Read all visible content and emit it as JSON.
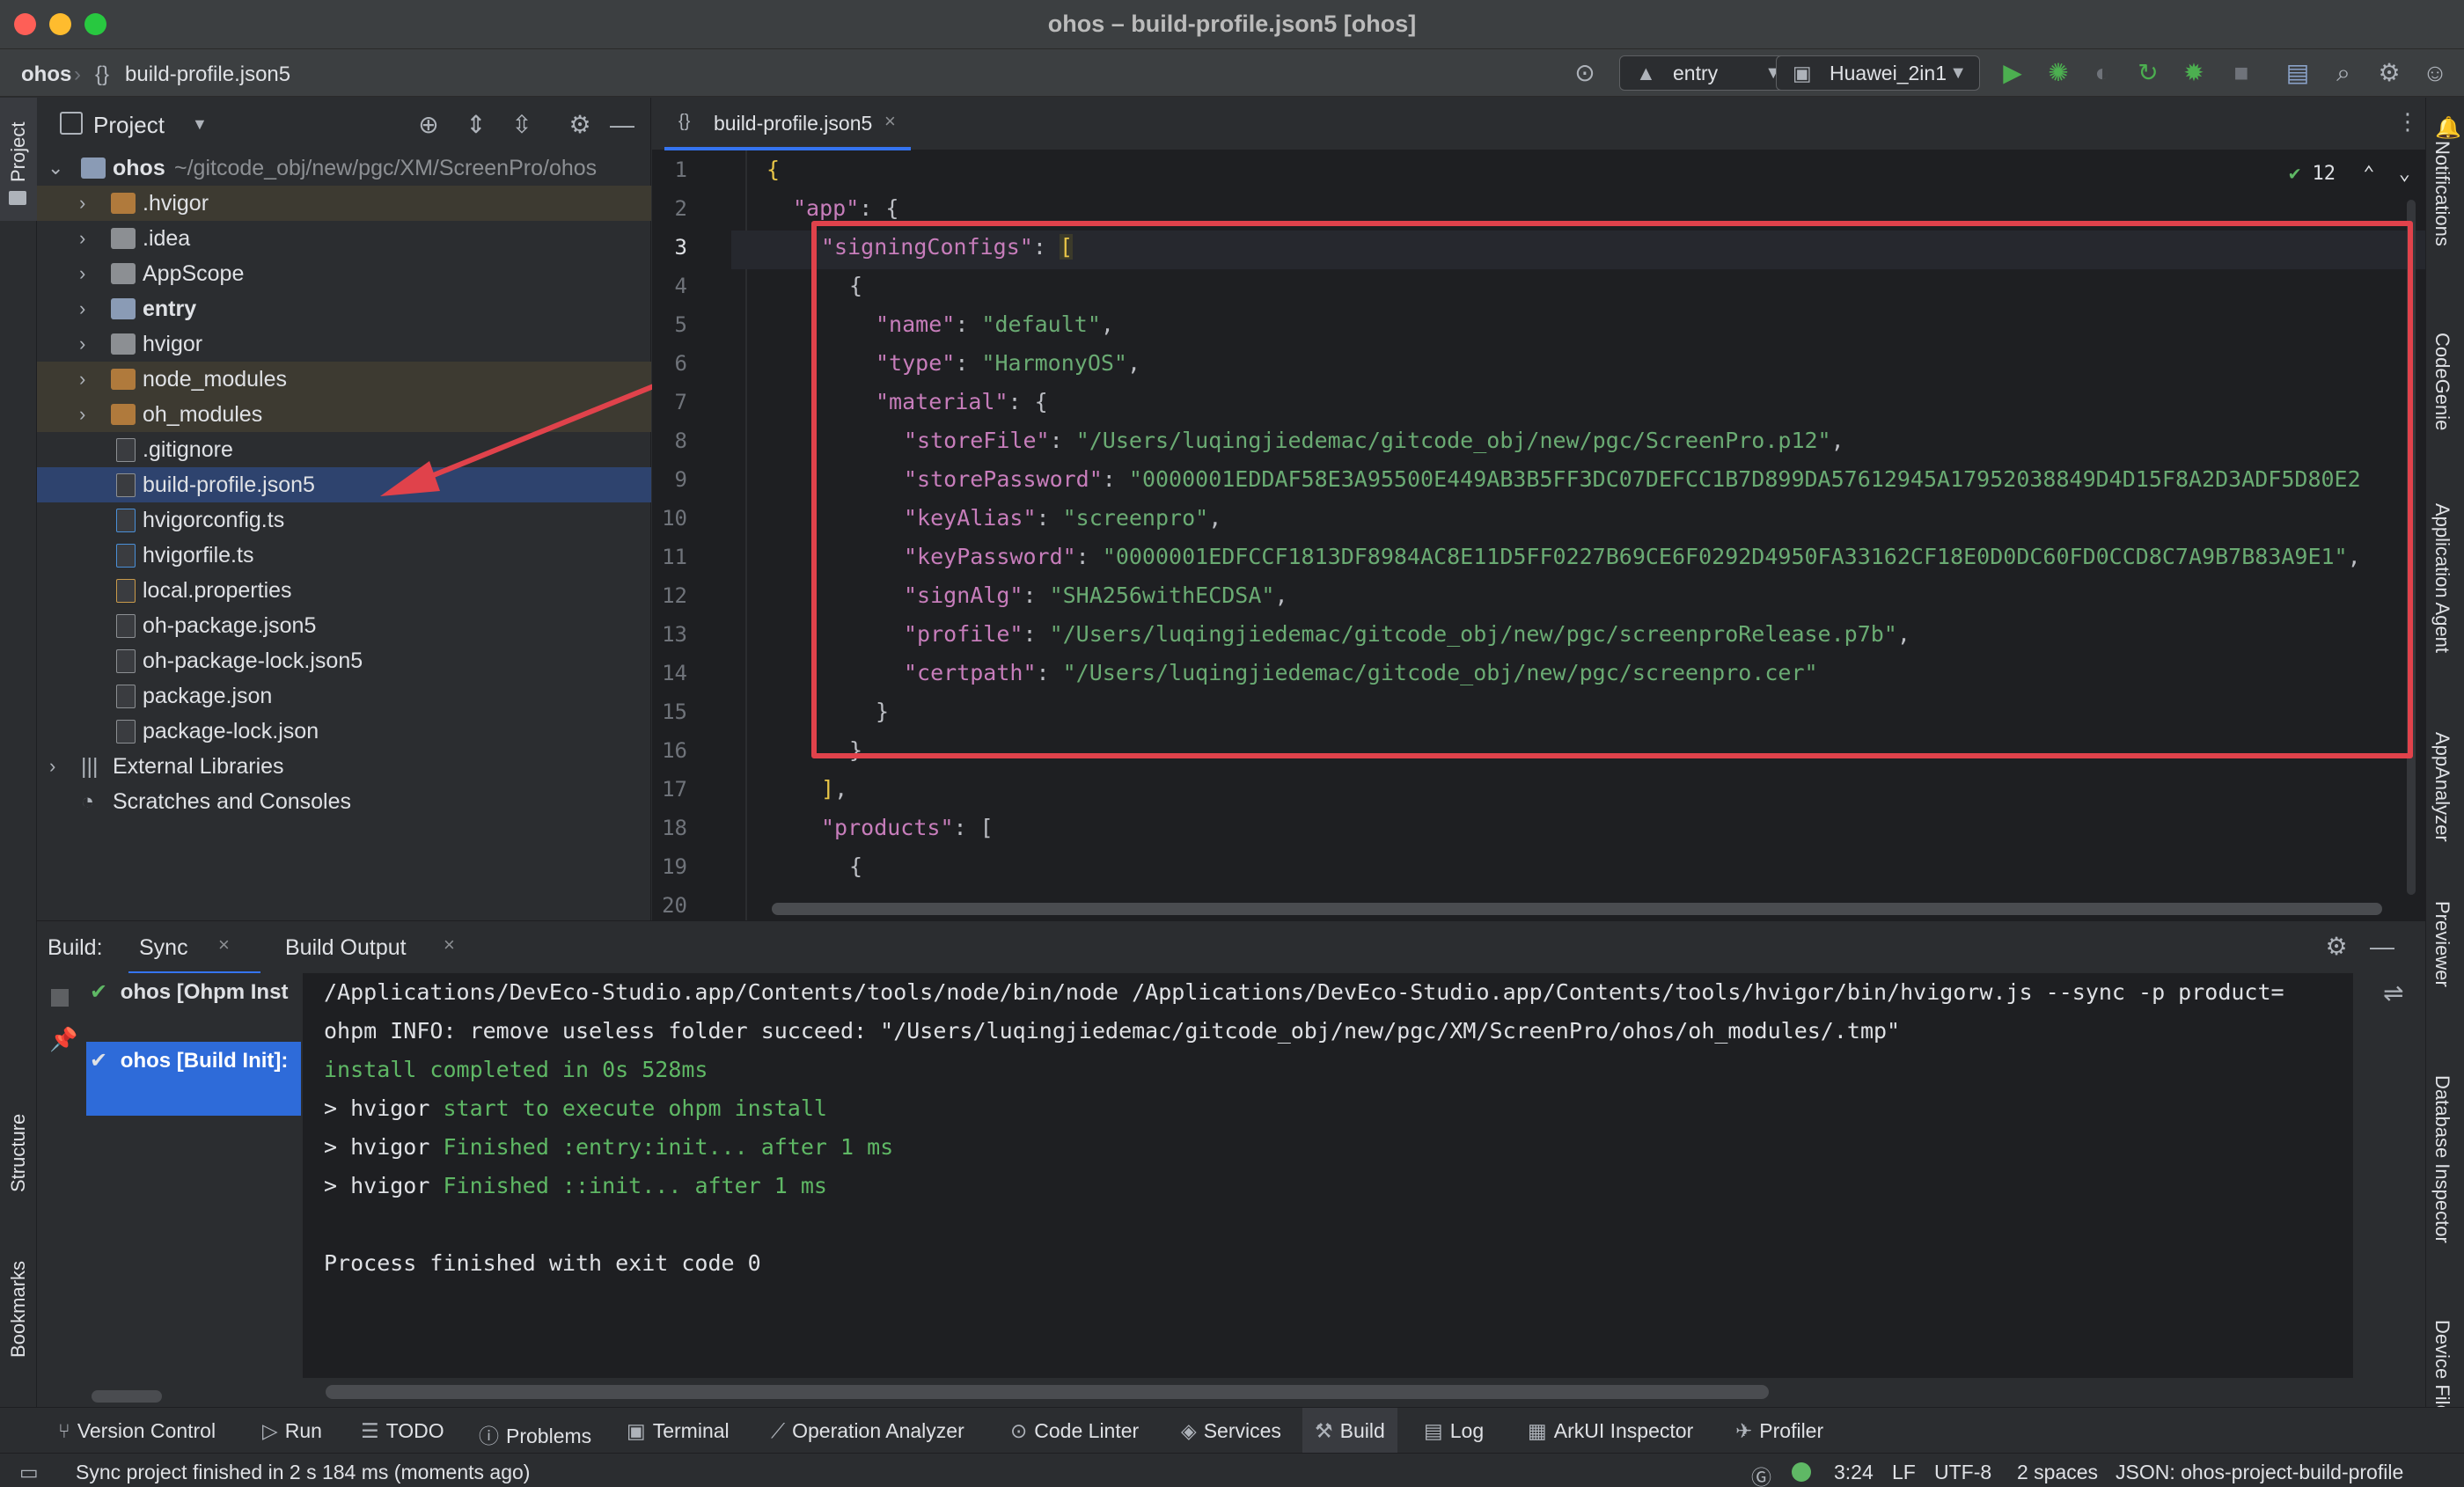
{
  "window": {
    "title": "ohos – build-profile.json5 [ohos]"
  },
  "nav": {
    "crumb_project": "ohos",
    "crumb_file": "build-profile.json5",
    "module_select": "entry",
    "device_select": "Huawei_2in1"
  },
  "left_strip": {
    "project_label": "Project",
    "structure_label": "Structure",
    "bookmarks_label": "Bookmarks"
  },
  "project": {
    "title": "Project",
    "root_name": "ohos",
    "root_path": "~/gitcode_obj/new/pgc/XM/ScreenPro/ohos",
    "items": [
      {
        "label": ".hvigor"
      },
      {
        "label": ".idea"
      },
      {
        "label": "AppScope"
      },
      {
        "label": "entry"
      },
      {
        "label": "hvigor"
      },
      {
        "label": "node_modules"
      },
      {
        "label": "oh_modules"
      },
      {
        "label": ".gitignore"
      },
      {
        "label": "build-profile.json5"
      },
      {
        "label": "hvigorconfig.ts"
      },
      {
        "label": "hvigorfile.ts"
      },
      {
        "label": "local.properties"
      },
      {
        "label": "oh-package.json5"
      },
      {
        "label": "oh-package-lock.json5"
      },
      {
        "label": "package.json"
      },
      {
        "label": "package-lock.json"
      },
      {
        "label": "External Libraries"
      },
      {
        "label": "Scratches and Consoles"
      }
    ]
  },
  "editor": {
    "tab_label": "build-profile.json5",
    "inspection_count": "12",
    "line_numbers": [
      "1",
      "2",
      "3",
      "4",
      "5",
      "6",
      "7",
      "8",
      "9",
      "10",
      "11",
      "12",
      "13",
      "14",
      "15",
      "16",
      "17",
      "18",
      "19",
      "20"
    ],
    "code": {
      "app_key": "\"app\"",
      "signing_key": "\"signingConfigs\"",
      "name_key": "\"name\"",
      "name_val": "\"default\"",
      "type_key": "\"type\"",
      "type_val": "\"HarmonyOS\"",
      "material_key": "\"material\"",
      "storefile_key": "\"storeFile\"",
      "storefile_val": "\"/Users/luqingjiedemac/gitcode_obj/new/pgc/ScreenPro.p12\"",
      "storepw_key": "\"storePassword\"",
      "storepw_val": "\"0000001EDDAF58E3A95500E449AB3B5FF3DC07DEFCC1B7D899DA57612945A17952038849D4D15F8A2D3ADF5D80E2",
      "keyalias_key": "\"keyAlias\"",
      "keyalias_val": "\"screenpro\"",
      "keypw_key": "\"keyPassword\"",
      "keypw_val": "\"0000001EDFCCF1813DF8984AC8E11D5FF0227B69CE6F0292D4950FA33162CF18E0D0DC60FD0CCD8C7A9B7B83A9E1\"",
      "signalg_key": "\"signAlg\"",
      "signalg_val": "\"SHA256withECDSA\"",
      "profile_key": "\"profile\"",
      "profile_val": "\"/Users/luqingjiedemac/gitcode_obj/new/pgc/screenproRelease.p7b\"",
      "certpath_key": "\"certpath\"",
      "certpath_val": "\"/Users/luqingjiedemac/gitcode_obj/new/pgc/screenpro.cer\"",
      "products_key": "\"products\""
    }
  },
  "right_strip": {
    "labels": [
      "Notifications",
      "CodeGenie",
      "Application Agent",
      "AppAnalyzer",
      "Previewer",
      "Database Inspector",
      "Device File"
    ]
  },
  "build": {
    "label": "Build:",
    "tab_sync": "Sync",
    "tab_output": "Build Output",
    "tree_item_1": "ohos [Ohpm Inst",
    "tree_item_2": "ohos [Build Init]:",
    "console": [
      "/Applications/DevEco-Studio.app/Contents/tools/node/bin/node /Applications/DevEco-Studio.app/Contents/tools/hvigor/bin/hvigorw.js --sync -p product=",
      "ohpm INFO: remove useless folder succeed: \"/Users/luqingjiedemac/gitcode_obj/new/pgc/XM/ScreenPro/ohos/oh_modules/.tmp\"",
      "install completed in 0s 528ms",
      "> hvigor ",
      "start to execute ohpm install",
      "Finished :entry:init... after 1 ms",
      "Finished ::init... after 1 ms",
      "Process finished with exit code 0"
    ]
  },
  "bottom_tabs": [
    "Version Control",
    "Run",
    "TODO",
    "Problems",
    "Terminal",
    "Operation Analyzer",
    "Code Linter",
    "Services",
    "Build",
    "Log",
    "ArkUI Inspector",
    "Profiler"
  ],
  "status": {
    "message": "Sync project finished in 2 s 184 ms (moments ago)",
    "position": "3:24",
    "line_sep": "LF",
    "encoding": "UTF-8",
    "indent": "2 spaces",
    "schema": "JSON: ohos-project-build-profile"
  },
  "colors": {
    "selection": "#2e436e",
    "red_box": "#e0424b",
    "green": "#5fb865",
    "string": "#6aab73",
    "key": "#c77dbb"
  }
}
